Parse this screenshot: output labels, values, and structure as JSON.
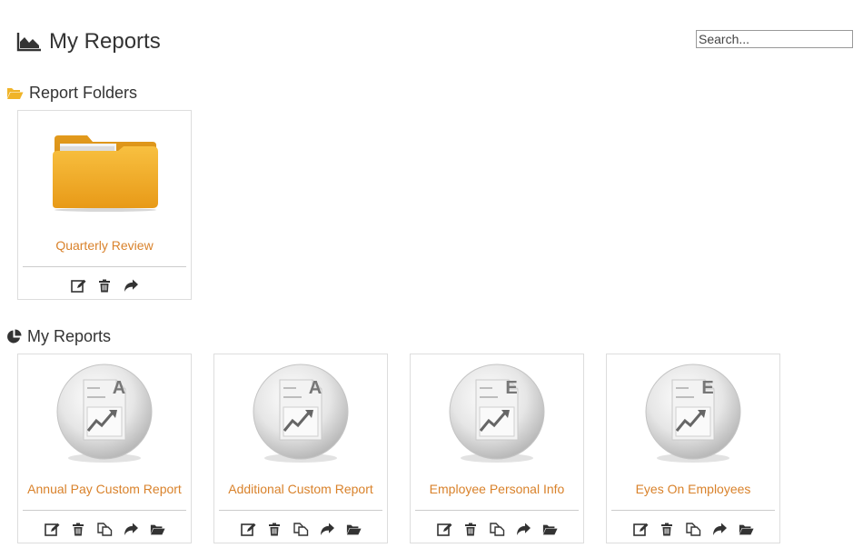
{
  "header": {
    "title": "My Reports",
    "icon": "area-chart-icon"
  },
  "search": {
    "placeholder": "Search..."
  },
  "colors": {
    "link": "#d9822b",
    "folder": "#f0b429",
    "icon": "#333333"
  },
  "folders_section": {
    "title": "Report Folders",
    "icon": "folder-open-icon",
    "items": [
      {
        "label": "Quarterly Review",
        "actions": [
          "edit-icon",
          "delete-icon",
          "share-icon"
        ]
      }
    ]
  },
  "reports_section": {
    "title": "My Reports",
    "icon": "pie-chart-icon",
    "items": [
      {
        "label": "Annual Pay Custom Report",
        "letter": "A",
        "actions": [
          "edit-icon",
          "delete-icon",
          "copy-icon",
          "share-icon",
          "move-to-folder-icon"
        ]
      },
      {
        "label": "Additional Custom Report",
        "letter": "A",
        "actions": [
          "edit-icon",
          "delete-icon",
          "copy-icon",
          "share-icon",
          "move-to-folder-icon"
        ]
      },
      {
        "label": "Employee Personal Info",
        "letter": "E",
        "actions": [
          "edit-icon",
          "delete-icon",
          "copy-icon",
          "share-icon",
          "move-to-folder-icon"
        ]
      },
      {
        "label": "Eyes On Employees",
        "letter": "E",
        "actions": [
          "edit-icon",
          "delete-icon",
          "copy-icon",
          "share-icon",
          "move-to-folder-icon"
        ]
      }
    ]
  }
}
